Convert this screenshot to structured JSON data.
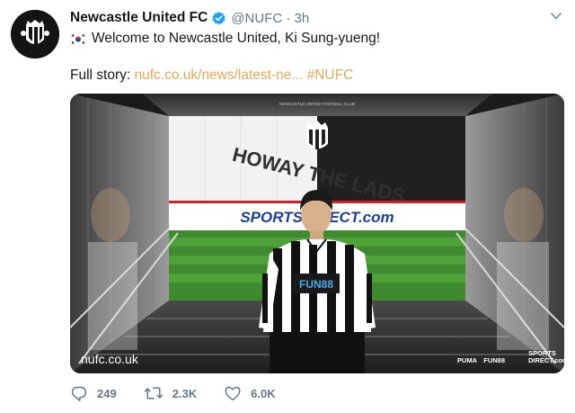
{
  "tweet": {
    "display_name": "Newcastle United FC",
    "handle": "@NUFC",
    "separator": " · ",
    "time": "3h",
    "line1": "Welcome to Newcastle United, Ki Sung-yueng!",
    "line2_prefix": "Full story: ",
    "link": "nufc.co.uk/news/latest-ne...",
    "hashtag": " #NUFC"
  },
  "media": {
    "club_header": "NEWCASTLE UNITED FOOTBALL CLUB",
    "banner": "HOWAY THE LADS",
    "board": "SPORTSDIRECT.com",
    "shirt_sponsor": "FUN88",
    "url": "nufc.co.uk",
    "sponsors": [
      "PUMA",
      "FUN88",
      "SPORTS DIRECT.com"
    ]
  },
  "actions": {
    "replies": "249",
    "retweets": "2.3K",
    "likes": "6.0K"
  },
  "icons": [
    "club-crest-icon",
    "verified-badge-icon",
    "chevron-down-icon",
    "south-korea-flag-icon",
    "reply-icon",
    "retweet-icon",
    "like-icon"
  ],
  "colors": {
    "link": "#e2a85a",
    "verified": "#1da1f2",
    "muted": "#657786"
  }
}
